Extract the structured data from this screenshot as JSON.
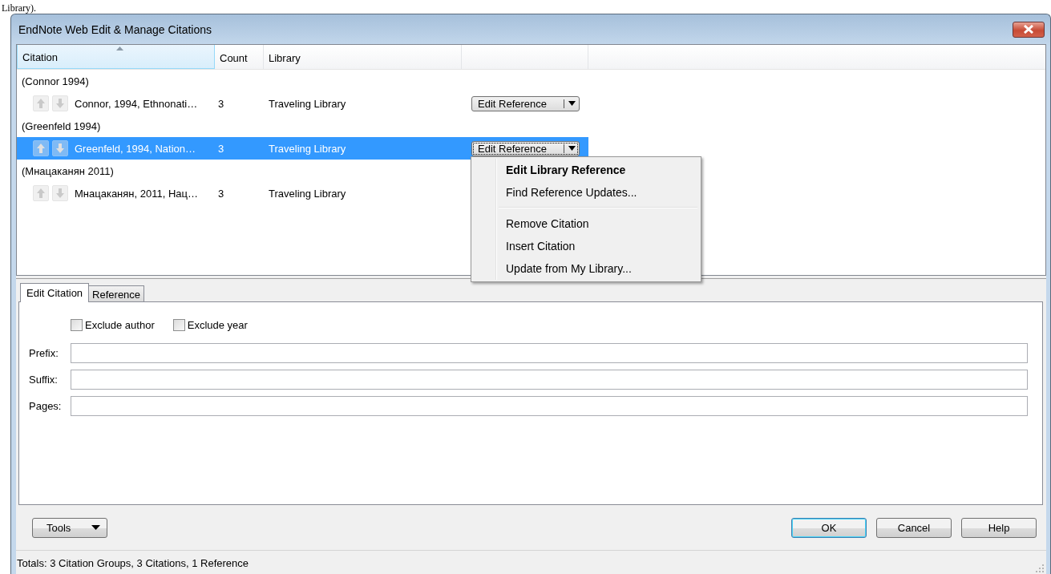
{
  "document_text": "Library).",
  "window": {
    "title": "EndNote Web Edit & Manage Citations"
  },
  "citations": {
    "columns": [
      {
        "label": "Citation",
        "sorted": true
      },
      {
        "label": "Count",
        "sorted": false
      },
      {
        "label": "Library",
        "sorted": false
      }
    ],
    "groups": [
      {
        "label": "(Connor 1994)",
        "items": [
          {
            "citation": "Connor, 1994, Ethnonati…",
            "count": "3",
            "library": "Traveling Library",
            "action": "Edit Reference",
            "selected": false
          }
        ]
      },
      {
        "label": "(Greenfeld 1994)",
        "items": [
          {
            "citation": "Greenfeld, 1994, Nation…",
            "count": "3",
            "library": "Traveling Library",
            "action": "Edit Reference",
            "selected": true
          }
        ]
      },
      {
        "label": "(Мнацаканян 2011)",
        "items": [
          {
            "citation": "Мнацаканян, 2011, Нац…",
            "count": "3",
            "library": "Traveling Library",
            "selected": false
          }
        ]
      }
    ]
  },
  "context_menu": {
    "items": [
      {
        "kind": "item",
        "label": "Edit Library Reference",
        "default": true
      },
      {
        "kind": "item",
        "label": "Find Reference Updates...",
        "default": false
      },
      {
        "kind": "separator"
      },
      {
        "kind": "item",
        "label": "Remove Citation",
        "default": false
      },
      {
        "kind": "item",
        "label": "Insert Citation",
        "default": false
      },
      {
        "kind": "item",
        "label": "Update from My Library...",
        "default": false
      }
    ]
  },
  "tabs": [
    {
      "label": "Edit Citation",
      "selected": true
    },
    {
      "label": "Reference",
      "selected": false
    }
  ],
  "options": [
    {
      "label": "Exclude author",
      "checked": false
    },
    {
      "label": "Exclude year",
      "checked": false
    }
  ],
  "fields": [
    {
      "label": "Prefix:"
    },
    {
      "label": "Suffix:"
    },
    {
      "label": "Pages:"
    }
  ],
  "tools_button": {
    "label": "Tools"
  },
  "buttons": [
    {
      "label": "OK",
      "default": true
    },
    {
      "label": "Cancel",
      "default": false
    },
    {
      "label": "Help",
      "default": false
    }
  ],
  "status_bar": "Totals: 3 Citation Groups, 3 Citations, 1 Reference"
}
